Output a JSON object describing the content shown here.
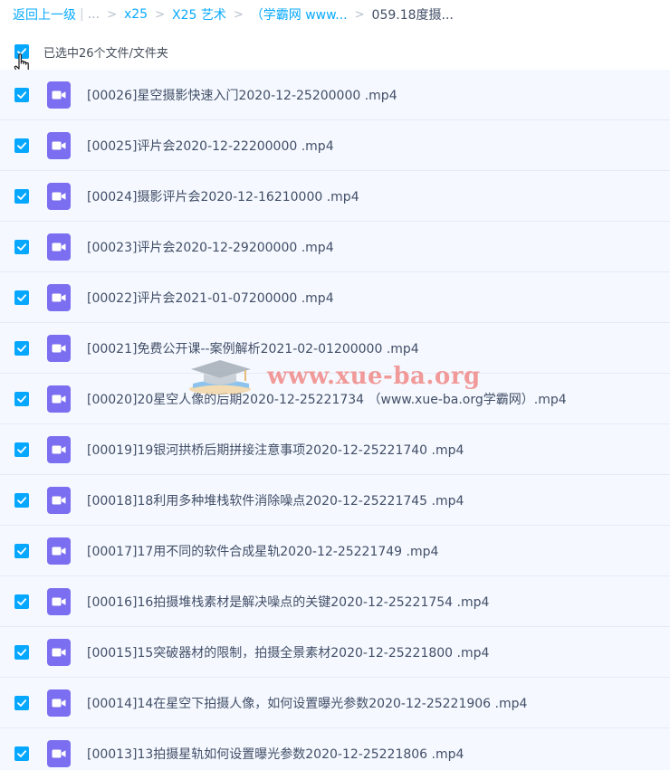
{
  "breadcrumb": {
    "back": "返回上一级",
    "divider": "|",
    "ellipsis": "...",
    "item1": "x25",
    "item2": "X25 艺术",
    "item3": "（学霸网 www...",
    "current": "059.18度摄..."
  },
  "header": {
    "select_all_label": "已选中26个文件/文件夹"
  },
  "files": [
    {
      "name": "[00026]星空摄影快速入门2020-12-25200000 .mp4"
    },
    {
      "name": "[00025]评片会2020-12-22200000 .mp4"
    },
    {
      "name": "[00024]摄影评片会2020-12-16210000 .mp4"
    },
    {
      "name": "[00023]评片会2020-12-29200000 .mp4"
    },
    {
      "name": "[00022]评片会2021-01-07200000 .mp4"
    },
    {
      "name": "[00021]免费公开课--案例解析2021-02-01200000 .mp4"
    },
    {
      "name": "[00020]20星空人像的后期2020-12-25221734 （www.xue-ba.org学霸网）.mp4"
    },
    {
      "name": "[00019]19银河拱桥后期拼接注意事项2020-12-25221740 .mp4"
    },
    {
      "name": "[00018]18利用多种堆栈软件消除噪点2020-12-25221745 .mp4"
    },
    {
      "name": "[00017]17用不同的软件合成星轨2020-12-25221749 .mp4"
    },
    {
      "name": "[00016]16拍摄堆栈素材是解决噪点的关键2020-12-25221754 .mp4"
    },
    {
      "name": "[00015]15突破器材的限制，拍摄全景素材2020-12-25221800 .mp4"
    },
    {
      "name": "[00014]14在星空下拍摄人像，如何设置曝光参数2020-12-25221906 .mp4"
    },
    {
      "name": "[00013]13拍摄星轨如何设置曝光参数2020-12-25221806 .mp4"
    }
  ],
  "watermark": {
    "text": "www.xue-ba.org"
  },
  "icons": {
    "checkbox": "checkmark-icon",
    "file": "video-file-icon",
    "cursor": "hand-cursor-icon",
    "watermark": "graduation-cap-icon"
  },
  "colors": {
    "link": "#09aaff",
    "checkbox": "#06a7ff",
    "video_icon": "#7b6ef0",
    "row_bg": "#f5f9ff",
    "watermark": "#f07b78"
  }
}
